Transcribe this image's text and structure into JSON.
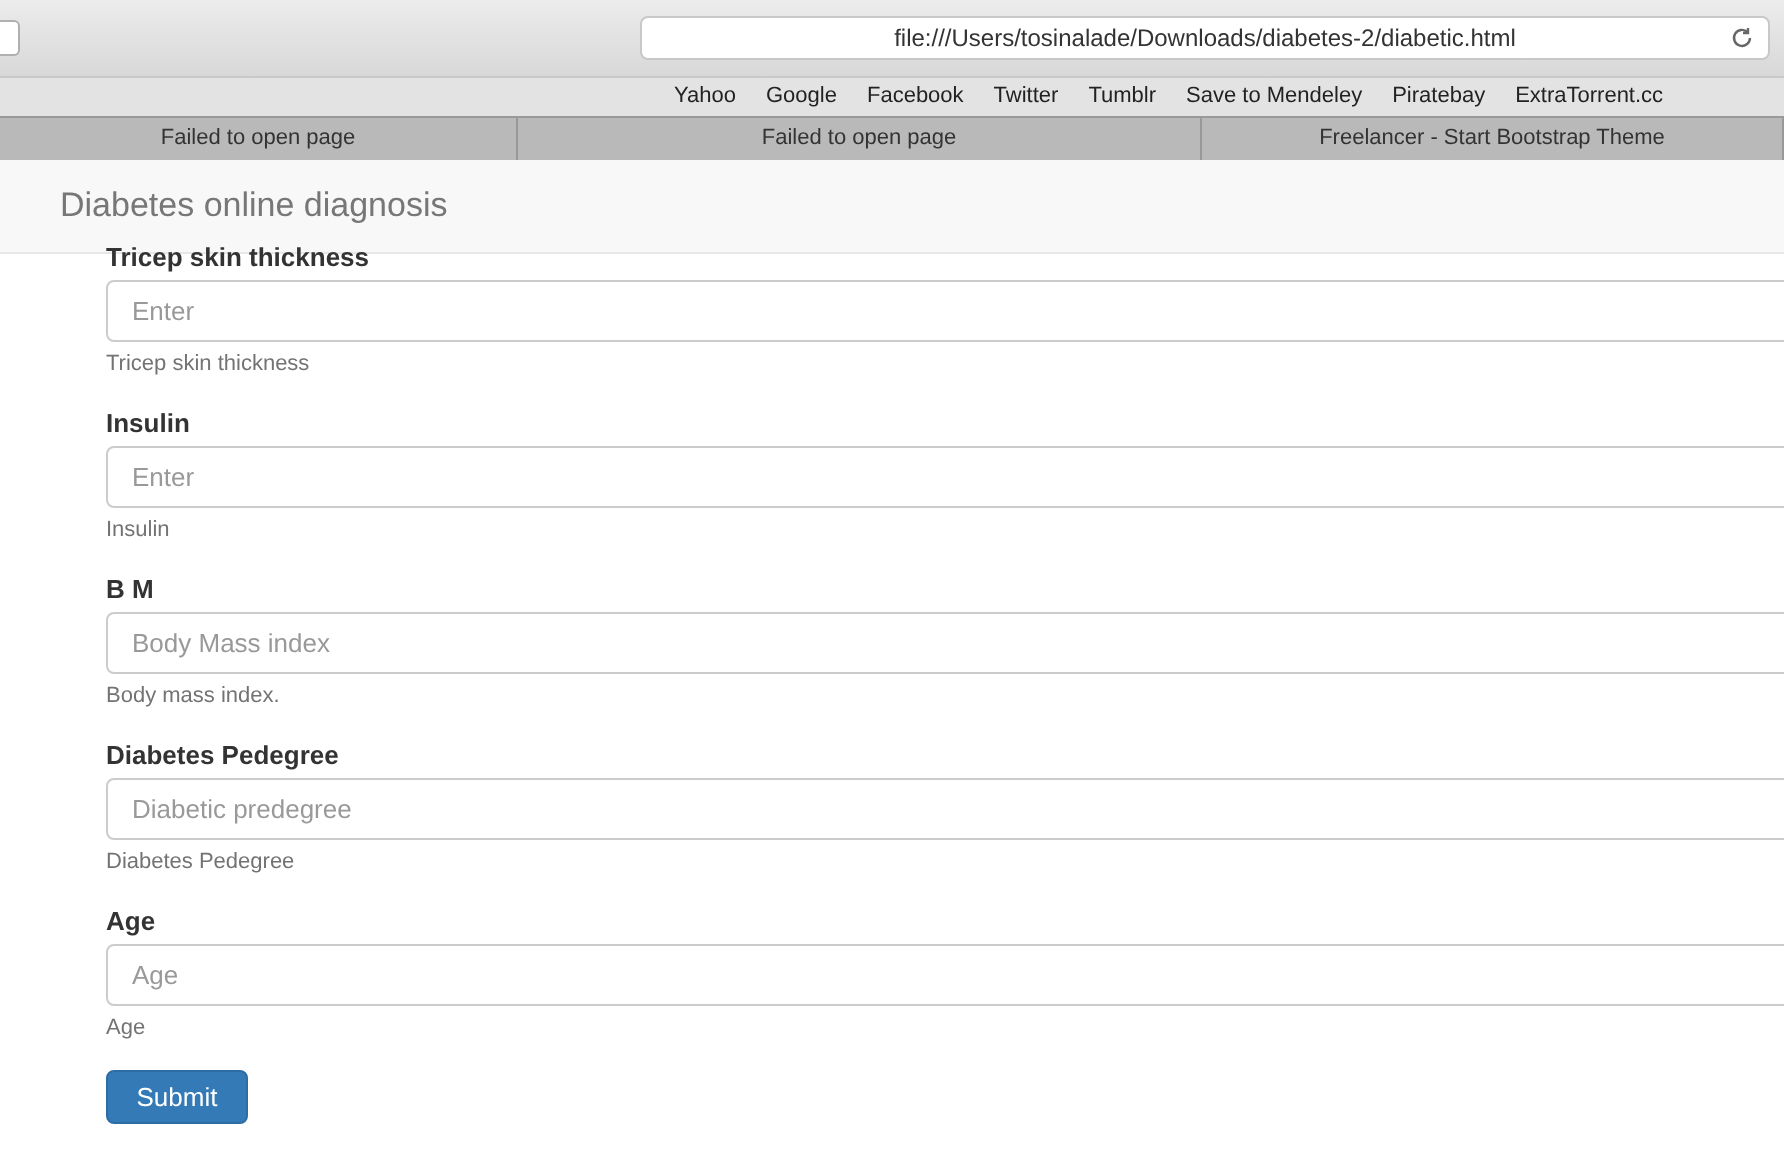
{
  "browser": {
    "url": "file:///Users/tosinalade/Downloads/diabetes-2/diabetic.html",
    "bookmarks": [
      "Yahoo",
      "Google",
      "Facebook",
      "Twitter",
      "Tumblr",
      "Save to Mendeley",
      "Piratebay",
      "ExtraTorrent.cc"
    ],
    "tabs": [
      {
        "label": "Failed to open page"
      },
      {
        "label": "Failed to open page"
      },
      {
        "label": "Freelancer - Start Bootstrap Theme"
      }
    ]
  },
  "navbar": {
    "brand": "Diabetes online diagnosis"
  },
  "form": {
    "fields": [
      {
        "label": "Tricep skin thickness",
        "placeholder": "Enter",
        "help": "Tricep skin thickness"
      },
      {
        "label": "Insulin",
        "placeholder": "Enter",
        "help": "Insulin"
      },
      {
        "label": "B M",
        "placeholder": "Body Mass index",
        "help": "Body mass index."
      },
      {
        "label": "Diabetes Pedegree",
        "placeholder": "Diabetic predegree",
        "help": "Diabetes Pedegree"
      },
      {
        "label": "Age",
        "placeholder": "Age",
        "help": "Age"
      }
    ],
    "submit": "Submit"
  }
}
